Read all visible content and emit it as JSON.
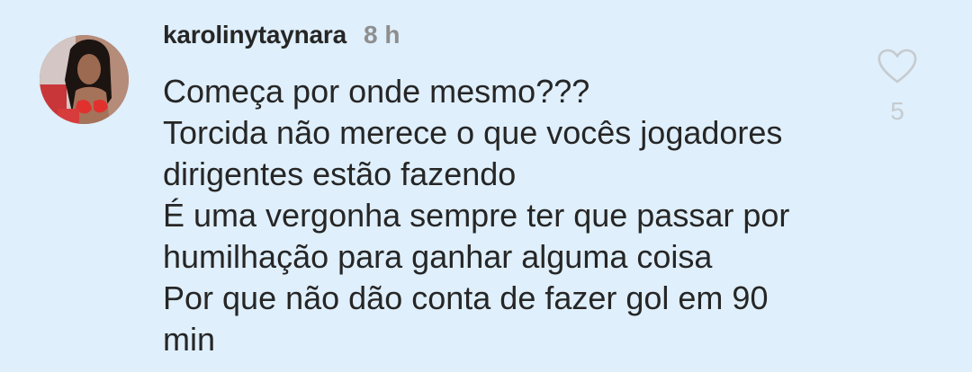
{
  "comment": {
    "username": "karolinytaynara",
    "timestamp": "8 h",
    "lines": [
      "Começa por onde mesmo???",
      "Torcida não merece o que vocês jogadores",
      "dirigentes estão fazendo",
      "É uma vergonha sempre ter que passar por",
      "humilhação para ganhar alguma coisa",
      "Por que não dão conta de fazer gol em 90",
      "min"
    ],
    "like_icon": "heart-outline-icon",
    "like_count": "5"
  },
  "colors": {
    "background": "#dfeffb",
    "text": "#262626",
    "muted": "#8e8e8e",
    "like": "#c5cbd0"
  }
}
